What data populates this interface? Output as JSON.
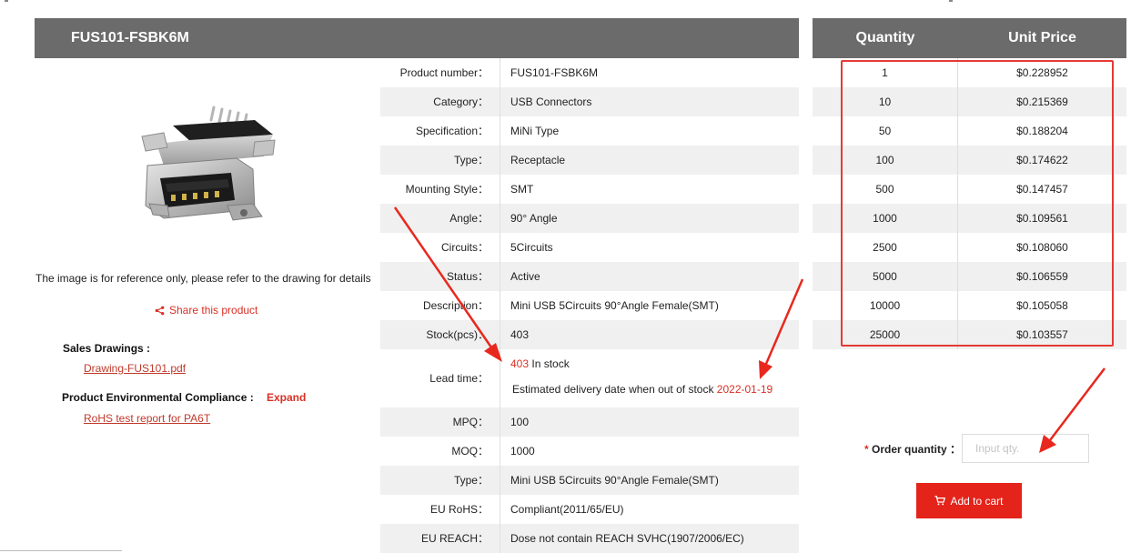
{
  "product": {
    "title": "FUS101-FSBK6M",
    "image_note": "The image is for reference only, please refer to the drawing for details",
    "share_label": "Share this product"
  },
  "documents": {
    "sales_drawings_label": "Sales Drawings :",
    "drawing_link": "Drawing-FUS101.pdf",
    "compliance_label": "Product Environmental Compliance :",
    "expand_label": "Expand",
    "rohs_link": "RoHS test report for PA6T"
  },
  "specs": [
    {
      "label": "Product number：",
      "value": "FUS101-FSBK6M"
    },
    {
      "label": "Category：",
      "value": "USB Connectors"
    },
    {
      "label": "Specification：",
      "value": "MiNi Type"
    },
    {
      "label": "Type：",
      "value": "Receptacle"
    },
    {
      "label": "Mounting Style：",
      "value": "SMT"
    },
    {
      "label": "Angle：",
      "value": "90° Angle"
    },
    {
      "label": "Circuits：",
      "value": "5Circuits"
    },
    {
      "label": "Status：",
      "value": "Active"
    },
    {
      "label": "Description：",
      "value": "Mini USB 5Circuits 90°Angle Female(SMT)"
    },
    {
      "label": "Stock(pcs)：",
      "value": "403"
    }
  ],
  "lead_time": {
    "label": "Lead time：",
    "stock_qty": "403",
    "stock_text": " In stock",
    "eta_text": "Estimated delivery date when out of stock ",
    "eta_date": "2022-01-19"
  },
  "specs2": [
    {
      "label": "MPQ：",
      "value": "100"
    },
    {
      "label": "MOQ：",
      "value": "1000"
    },
    {
      "label": "Type：",
      "value": "Mini USB 5Circuits 90°Angle Female(SMT)"
    },
    {
      "label": "EU RoHS：",
      "value": "Compliant(2011/65/EU)"
    },
    {
      "label": "EU REACH：",
      "value": "Dose not contain REACH SVHC(1907/2006/EC)"
    }
  ],
  "pricing": {
    "quantity_header": "Quantity",
    "price_header": "Unit Price",
    "rows": [
      {
        "qty": "1",
        "price": "$0.228952"
      },
      {
        "qty": "10",
        "price": "$0.215369"
      },
      {
        "qty": "50",
        "price": "$0.188204"
      },
      {
        "qty": "100",
        "price": "$0.174622"
      },
      {
        "qty": "500",
        "price": "$0.147457"
      },
      {
        "qty": "1000",
        "price": "$0.109561"
      },
      {
        "qty": "2500",
        "price": "$0.108060"
      },
      {
        "qty": "5000",
        "price": "$0.106559"
      },
      {
        "qty": "10000",
        "price": "$0.105058"
      },
      {
        "qty": "25000",
        "price": "$0.103557"
      }
    ]
  },
  "order": {
    "star": "*",
    "label": " Order quantity ：",
    "placeholder": "Input qty.",
    "add_to_cart": "Add to cart"
  },
  "colors": {
    "header_bg": "#6b6b6b",
    "accent_red": "#e4231a",
    "row_gray": "#f0f0f0"
  },
  "icons": [
    "share-icon",
    "cart-icon"
  ]
}
